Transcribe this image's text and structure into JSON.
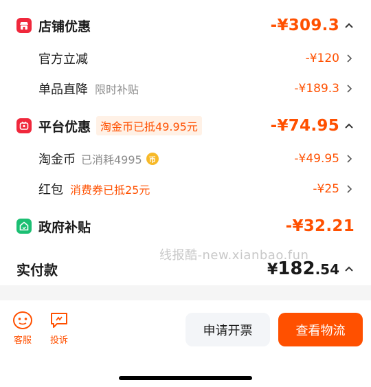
{
  "store_discount": {
    "title": "店铺优惠",
    "amount": "-¥309.3"
  },
  "official_reduction": {
    "label": "官方立减",
    "amount": "-¥120"
  },
  "single_item": {
    "label": "单品直降",
    "tag": "限时补贴",
    "amount": "-¥189.3"
  },
  "platform_discount": {
    "title": "平台优惠",
    "tag": "淘金币已抵49.95元",
    "amount": "-¥74.95"
  },
  "taojinbi": {
    "label": "淘金币",
    "tag": "已消耗4995",
    "coin_glyph": "币",
    "amount": "-¥49.95"
  },
  "red_packet": {
    "label": "红包",
    "tag": "消费券已抵25元",
    "amount": "-¥25"
  },
  "gov_subsidy": {
    "title": "政府补贴",
    "amount": "-¥32.21"
  },
  "watermark": "线报酷-new.xianbao.fun",
  "total": {
    "label": "实付款",
    "currency": "¥",
    "integer": "182",
    "decimal": ".54"
  },
  "bottom": {
    "service_label": "客服",
    "complaint_label": "投诉",
    "invoice_button": "申请开票",
    "logistics_button": "查看物流"
  },
  "colors": {
    "accent": "#ff5000",
    "store_icon": "#f0283c",
    "gov_icon": "#1cbf73",
    "coin": "#f7b928"
  }
}
